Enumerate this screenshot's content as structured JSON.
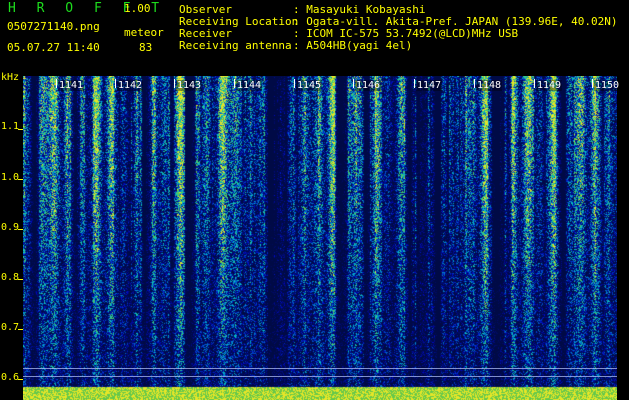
{
  "header": {
    "app_title": "H R O F F T",
    "version": "1.00",
    "filename": "0507271140.png",
    "datetime": "05.07.27 11:40",
    "meteor_label": "meteor",
    "meteor_count": "83"
  },
  "info": [
    {
      "key": "Observer",
      "value": ": Masayuki Kobayashi"
    },
    {
      "key": "Receiving Location",
      "value": ": Ogata-vill. Akita-Pref. JAPAN (139.96E, 40.02N)"
    },
    {
      "key": "Receiver",
      "value": ": ICOM IC-575 53.7492(@LCD)MHz USB"
    },
    {
      "key": "Receiving antenna",
      "value": ": A504HB(yagi 4el)"
    }
  ],
  "axis": {
    "unit": "kHz",
    "ticks": [
      "1.1",
      "1.0",
      "0.9",
      "0.8",
      "0.7",
      "0.6"
    ]
  },
  "time_labels": [
    "1141",
    "1142",
    "1143",
    "1144",
    "1145",
    "1146",
    "1147",
    "1148",
    "1149",
    "1150"
  ],
  "colors": {
    "text": "#ffff00",
    "title": "#1ddc1d",
    "background": "#000000"
  }
}
